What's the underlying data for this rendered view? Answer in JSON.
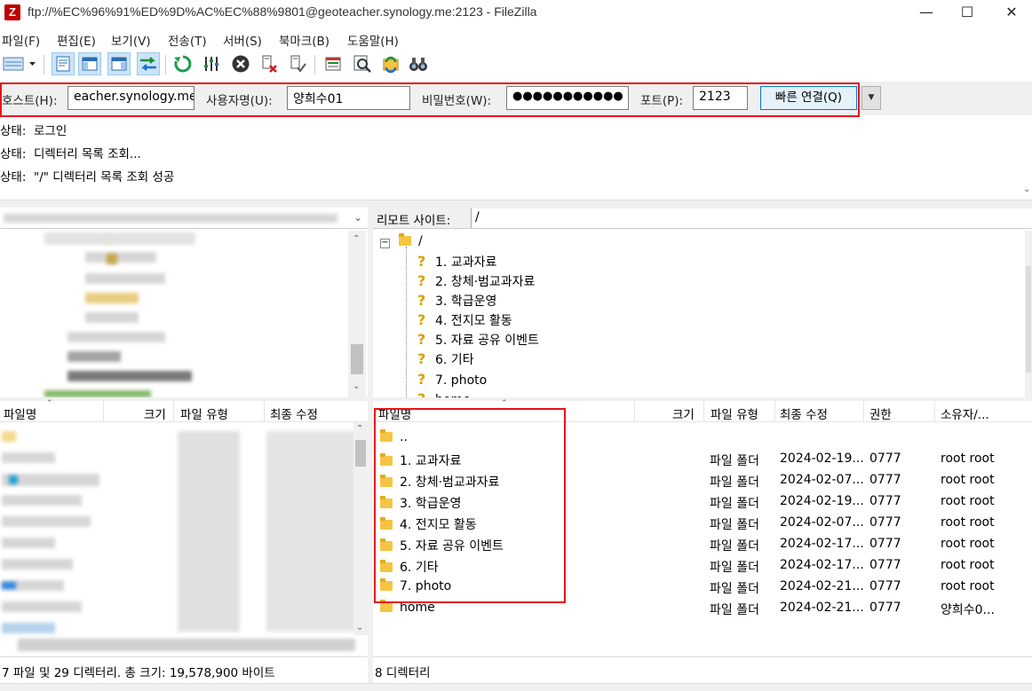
{
  "window": {
    "title": "ftp://%EC%96%91%ED%9D%AC%EC%88%9801@geoteacher.synology.me:2123 - FileZilla",
    "app_icon": "filezilla-icon",
    "min_glyph": "—",
    "max_glyph": "☐",
    "close_glyph": "✕"
  },
  "menu": [
    "파일(F)",
    "편집(E)",
    "보기(V)",
    "전송(T)",
    "서버(S)",
    "북마크(B)",
    "도움말(H)"
  ],
  "quick_connect": {
    "host_label": "호스트(H):",
    "host_value": "eacher.synology.me",
    "user_label": "사용자명(U):",
    "user_value": "양희수01",
    "password_label": "비밀번호(W):",
    "password_value": "●●●●●●●●●●●",
    "port_label": "포트(P):",
    "port_value": "2123",
    "connect_button": "빠른 연결(Q)",
    "dropdown_glyph": "▼"
  },
  "log": [
    {
      "label": "상태:",
      "text": "로그인"
    },
    {
      "label": "상태:",
      "text": "디렉터리 목록 조회..."
    },
    {
      "label": "상태:",
      "text": "\"/\" 디렉터리 목록 조회 성공"
    }
  ],
  "remote_site": {
    "label": "리모트 사이트:",
    "path": "/",
    "tree_root": "/",
    "tree_items": [
      "1. 교과자료",
      "2. 창체·범교과자료",
      "3. 학급운영",
      "4. 전지모 활동",
      "5. 자료 공유 이벤트",
      "6. 기타",
      "7. photo",
      "home"
    ]
  },
  "local_list": {
    "columns": [
      "파일명",
      "크기",
      "파일 유형",
      "최종 수정"
    ],
    "status": "7 파일 및 29 디렉터리. 총 크기: 19,578,900 바이트"
  },
  "remote_list": {
    "columns": [
      "파일명",
      "크기",
      "파일 유형",
      "최종 수정",
      "권한",
      "소유자/..."
    ],
    "rows": [
      {
        "name": "..",
        "type": "",
        "modified": "",
        "perm": "",
        "owner": ""
      },
      {
        "name": "1. 교과자료",
        "type": "파일 폴더",
        "modified": "2024-02-19...",
        "perm": "0777",
        "owner": "root root"
      },
      {
        "name": "2. 창체·범교과자료",
        "type": "파일 폴더",
        "modified": "2024-02-07...",
        "perm": "0777",
        "owner": "root root"
      },
      {
        "name": "3. 학급운영",
        "type": "파일 폴더",
        "modified": "2024-02-19...",
        "perm": "0777",
        "owner": "root root"
      },
      {
        "name": "4. 전지모 활동",
        "type": "파일 폴더",
        "modified": "2024-02-07...",
        "perm": "0777",
        "owner": "root root"
      },
      {
        "name": "5. 자료 공유 이벤트",
        "type": "파일 폴더",
        "modified": "2024-02-17...",
        "perm": "0777",
        "owner": "root root"
      },
      {
        "name": "6. 기타",
        "type": "파일 폴더",
        "modified": "2024-02-17...",
        "perm": "0777",
        "owner": "root root"
      },
      {
        "name": "7. photo",
        "type": "파일 폴더",
        "modified": "2024-02-21...",
        "perm": "0777",
        "owner": "root root"
      },
      {
        "name": "home",
        "type": "파일 폴더",
        "modified": "2024-02-21...",
        "perm": "0777",
        "owner": "양희수0..."
      }
    ],
    "status": "8 디렉터리"
  },
  "colors": {
    "highlight": "#e8141b",
    "folder": "#f4c542",
    "accent": "#0078d7"
  }
}
